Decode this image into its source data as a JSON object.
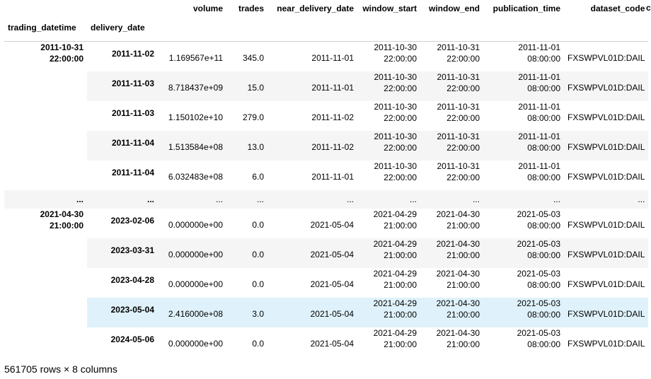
{
  "columns": {
    "volume": "volume",
    "trades": "trades",
    "near_delivery_date": "near_delivery_date",
    "window_start": "window_start",
    "window_end": "window_end",
    "publication_time": "publication_time",
    "dataset_code": "dataset_code",
    "cut": "c"
  },
  "index_names": {
    "trading_datetime": "trading_datetime",
    "delivery_date": "delivery_date"
  },
  "groups": [
    {
      "date": "2011-10-31",
      "time": "22:00:00"
    },
    {
      "date": "2021-04-30",
      "time": "21:00:00"
    }
  ],
  "ellipsis": "...",
  "rows": [
    {
      "delivery_date": "2011-11-02",
      "volume": "1.169567e+11",
      "trades": "345.0",
      "near_delivery_date": "2011-11-01",
      "ws_d": "2011-10-30",
      "ws_t": "22:00:00",
      "we_d": "2011-10-31",
      "we_t": "22:00:00",
      "pt_d": "2011-11-01",
      "pt_t": "08:00:00",
      "dataset_code": "FXSWPVL01D:DAIL"
    },
    {
      "delivery_date": "2011-11-03",
      "volume": "8.718437e+09",
      "trades": "15.0",
      "near_delivery_date": "2011-11-01",
      "ws_d": "2011-10-30",
      "ws_t": "22:00:00",
      "we_d": "2011-10-31",
      "we_t": "22:00:00",
      "pt_d": "2011-11-01",
      "pt_t": "08:00:00",
      "dataset_code": "FXSWPVL01D:DAIL"
    },
    {
      "delivery_date": "2011-11-03",
      "volume": "1.150102e+10",
      "trades": "279.0",
      "near_delivery_date": "2011-11-02",
      "ws_d": "2011-10-30",
      "ws_t": "22:00:00",
      "we_d": "2011-10-31",
      "we_t": "22:00:00",
      "pt_d": "2011-11-01",
      "pt_t": "08:00:00",
      "dataset_code": "FXSWPVL01D:DAIL"
    },
    {
      "delivery_date": "2011-11-04",
      "volume": "1.513584e+08",
      "trades": "13.0",
      "near_delivery_date": "2011-11-02",
      "ws_d": "2011-10-30",
      "ws_t": "22:00:00",
      "we_d": "2011-10-31",
      "we_t": "22:00:00",
      "pt_d": "2011-11-01",
      "pt_t": "08:00:00",
      "dataset_code": "FXSWPVL01D:DAIL"
    },
    {
      "delivery_date": "2011-11-04",
      "volume": "6.032483e+08",
      "trades": "6.0",
      "near_delivery_date": "2011-11-01",
      "ws_d": "2011-10-30",
      "ws_t": "22:00:00",
      "we_d": "2011-10-31",
      "we_t": "22:00:00",
      "pt_d": "2011-11-01",
      "pt_t": "08:00:00",
      "dataset_code": "FXSWPVL01D:DAIL"
    },
    {
      "delivery_date": "2023-02-06",
      "volume": "0.000000e+00",
      "trades": "0.0",
      "near_delivery_date": "2021-05-04",
      "ws_d": "2021-04-29",
      "ws_t": "21:00:00",
      "we_d": "2021-04-30",
      "we_t": "21:00:00",
      "pt_d": "2021-05-03",
      "pt_t": "08:00:00",
      "dataset_code": "FXSWPVL01D:DAIL"
    },
    {
      "delivery_date": "2023-03-31",
      "volume": "0.000000e+00",
      "trades": "0.0",
      "near_delivery_date": "2021-05-04",
      "ws_d": "2021-04-29",
      "ws_t": "21:00:00",
      "we_d": "2021-04-30",
      "we_t": "21:00:00",
      "pt_d": "2021-05-03",
      "pt_t": "08:00:00",
      "dataset_code": "FXSWPVL01D:DAIL"
    },
    {
      "delivery_date": "2023-04-28",
      "volume": "0.000000e+00",
      "trades": "0.0",
      "near_delivery_date": "2021-05-04",
      "ws_d": "2021-04-29",
      "ws_t": "21:00:00",
      "we_d": "2021-04-30",
      "we_t": "21:00:00",
      "pt_d": "2021-05-03",
      "pt_t": "08:00:00",
      "dataset_code": "FXSWPVL01D:DAIL"
    },
    {
      "delivery_date": "2023-05-04",
      "volume": "2.416000e+08",
      "trades": "3.0",
      "near_delivery_date": "2021-05-04",
      "ws_d": "2021-04-29",
      "ws_t": "21:00:00",
      "we_d": "2021-04-30",
      "we_t": "21:00:00",
      "pt_d": "2021-05-03",
      "pt_t": "08:00:00",
      "dataset_code": "FXSWPVL01D:DAIL"
    },
    {
      "delivery_date": "2024-05-06",
      "volume": "0.000000e+00",
      "trades": "0.0",
      "near_delivery_date": "2021-05-04",
      "ws_d": "2021-04-29",
      "ws_t": "21:00:00",
      "we_d": "2021-04-30",
      "we_t": "21:00:00",
      "pt_d": "2021-05-03",
      "pt_t": "08:00:00",
      "dataset_code": "FXSWPVL01D:DAIL"
    }
  ],
  "highlight_color": "#dff2fb",
  "stripe_color": "#f5f5f5",
  "footer": "561705 rows × 8 columns"
}
